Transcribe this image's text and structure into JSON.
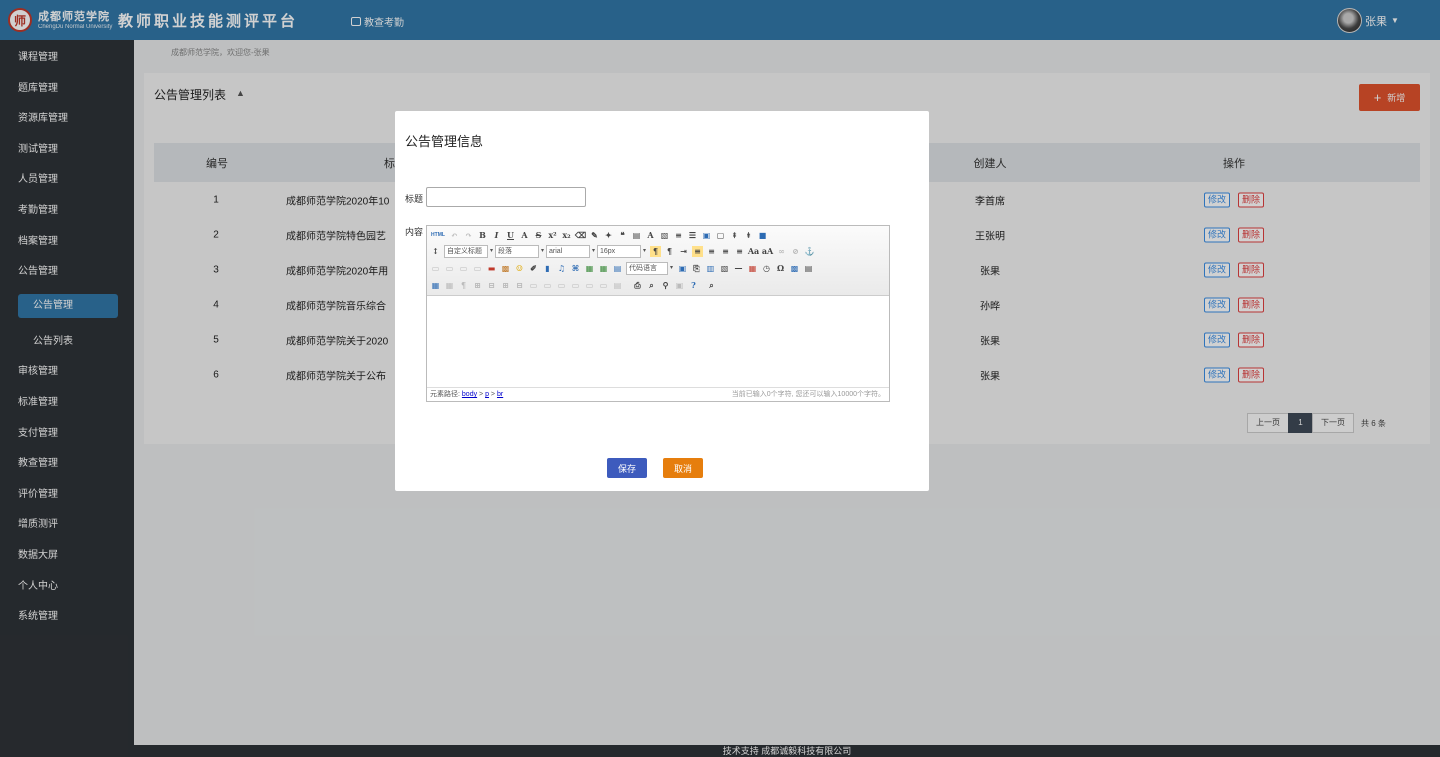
{
  "header": {
    "logo_seal": "师",
    "logo_cn": "成都师范学院",
    "logo_en": "ChengDu Normal University",
    "platform_title": "教师职业技能测评平台",
    "nav_link": "教查考勤",
    "user_name": "张果"
  },
  "sidebar": {
    "items": [
      {
        "label": "课程管理"
      },
      {
        "label": "题库管理"
      },
      {
        "label": "资源库管理"
      },
      {
        "label": "测试管理"
      },
      {
        "label": "人员管理"
      },
      {
        "label": "考勤管理"
      },
      {
        "label": "档案管理"
      },
      {
        "label": "公告管理"
      },
      {
        "label": "公告管理"
      },
      {
        "label": "公告列表"
      },
      {
        "label": "审核管理"
      },
      {
        "label": "标准管理"
      },
      {
        "label": "支付管理"
      },
      {
        "label": "教查管理"
      },
      {
        "label": "评价管理"
      },
      {
        "label": "增质测评"
      },
      {
        "label": "数据大屏"
      },
      {
        "label": "个人中心"
      },
      {
        "label": "系统管理"
      }
    ]
  },
  "breadcrumb": "成都师范学院，欢迎您-张果",
  "panel": {
    "title": "公告管理列表",
    "add_button": "新增",
    "columns": {
      "id": "编号",
      "title": "标",
      "creator": "创建人",
      "operation": "操作"
    },
    "rows": [
      {
        "id": "1",
        "title": "成都师范学院2020年10",
        "creator": "李首席"
      },
      {
        "id": "2",
        "title": "成都师范学院特色园艺",
        "creator": "王张明"
      },
      {
        "id": "3",
        "title": "成都师范学院2020年用",
        "creator": "张果"
      },
      {
        "id": "4",
        "title": "成都师范学院音乐综合",
        "creator": "孙晔"
      },
      {
        "id": "5",
        "title": "成都师范学院关于2020",
        "creator": "张果"
      },
      {
        "id": "6",
        "title": "成都师范学院关于公布",
        "creator": "张果"
      }
    ],
    "edit_label": "修改",
    "delete_label": "删除",
    "pager": {
      "prev": "上一页",
      "current": "1",
      "next": "下一页",
      "total": "共 6 条"
    }
  },
  "modal": {
    "title": "公告管理信息",
    "title_label": "标题",
    "title_value": "",
    "content_label": "内容",
    "editor": {
      "html_btn": "HTML",
      "heading_select": "自定义标题",
      "paragraph_select": "段落",
      "font_select": "arial",
      "size_select": "16px",
      "code_lang_select": "代码语言",
      "path_label": "元素路径:",
      "path_body": "body",
      "path_p": "p",
      "path_br": "br",
      "word_count": "当前已输入0个字符, 您还可以输入10000个字符。"
    },
    "save": "保存",
    "cancel": "取消"
  },
  "footer": "技术支持 成都诚毅科技有限公司"
}
